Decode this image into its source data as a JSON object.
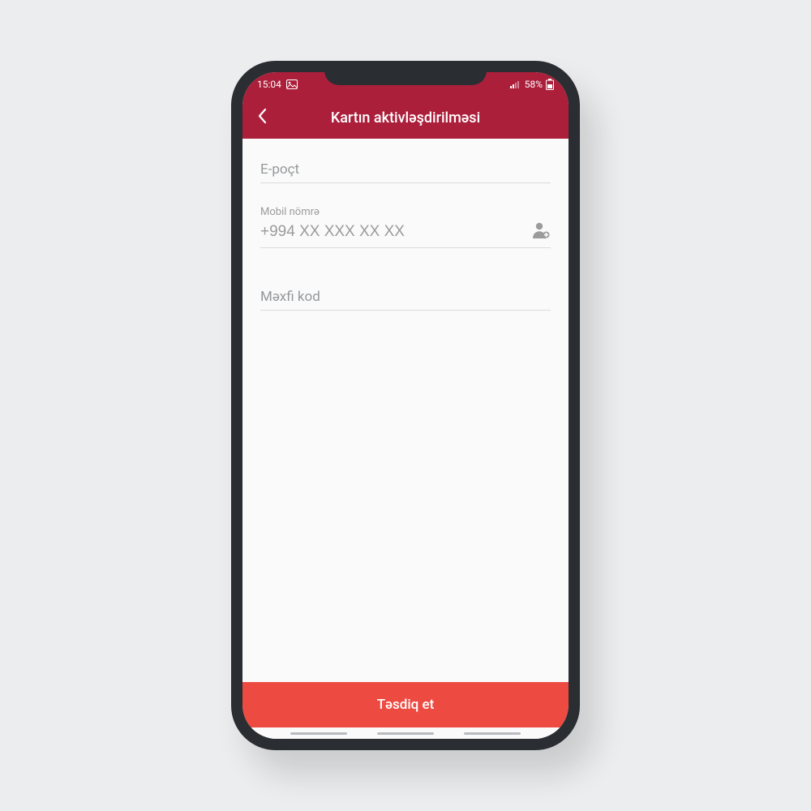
{
  "status": {
    "time": "15:04",
    "battery_text": "58%"
  },
  "header": {
    "title": "Kartın aktivləşdirilməsi"
  },
  "form": {
    "email": {
      "label": "E-poçt"
    },
    "mobile": {
      "label": "Mobil nömrə",
      "placeholder": "+994 XX XXX XX XX"
    },
    "secret": {
      "label": "Məxfi kod"
    }
  },
  "actions": {
    "confirm": "Təsdiq et"
  }
}
